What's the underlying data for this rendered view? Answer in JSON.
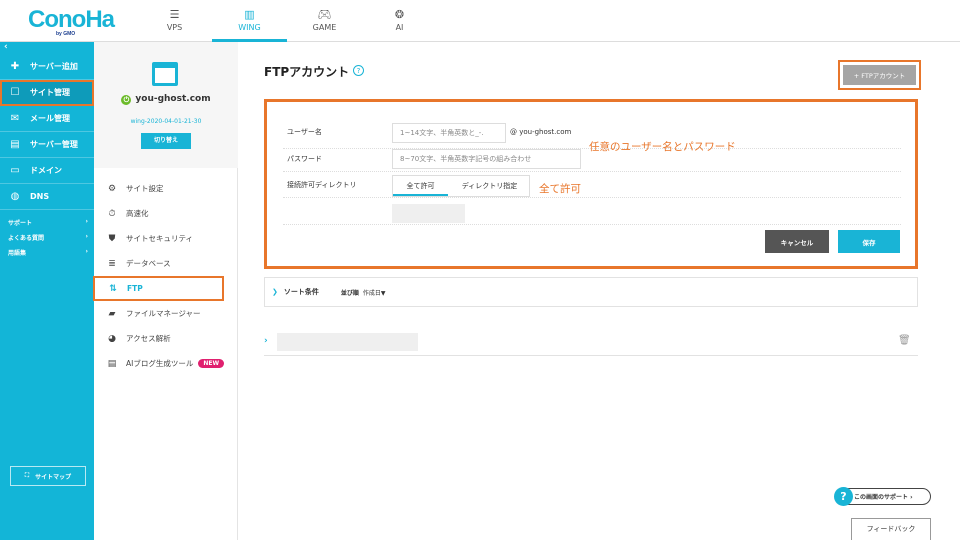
{
  "header": {
    "logo": "ConoHa",
    "logo_sub": "by GMO",
    "tabs": [
      {
        "label": "VPS",
        "icon": "server-icon"
      },
      {
        "label": "WING",
        "icon": "wing-icon"
      },
      {
        "label": "GAME",
        "icon": "gamepad-icon"
      },
      {
        "label": "AI",
        "icon": "brain-icon"
      }
    ]
  },
  "sidebar": {
    "collapse": "‹",
    "items": [
      {
        "label": "サーバー追加",
        "icon": "plus-icon"
      },
      {
        "label": "サイト管理",
        "icon": "window-icon"
      },
      {
        "label": "メール管理",
        "icon": "mail-icon"
      },
      {
        "label": "サーバー管理",
        "icon": "server-icon"
      },
      {
        "label": "ドメイン",
        "icon": "domain-icon"
      },
      {
        "label": "DNS",
        "icon": "globe-icon"
      }
    ],
    "links": [
      "サポート",
      "よくある質問",
      "用語集"
    ],
    "sitemap": "サイトマップ"
  },
  "subpanel": {
    "domain": "you-ghost.com",
    "wing_id": "wing-2020-04-01-21-30",
    "switch": "切り替え",
    "menu": [
      {
        "label": "サイト設定",
        "icon": "site-settings-icon"
      },
      {
        "label": "高速化",
        "icon": "stopwatch-icon"
      },
      {
        "label": "サイトセキュリティ",
        "icon": "shield-icon"
      },
      {
        "label": "データベース",
        "icon": "database-icon"
      },
      {
        "label": "FTP",
        "icon": "ftp-arrows-icon"
      },
      {
        "label": "ファイルマネージャー",
        "icon": "folder-icon"
      },
      {
        "label": "アクセス解析",
        "icon": "pie-chart-icon"
      },
      {
        "label": "AIブログ生成ツール",
        "icon": "document-icon"
      }
    ],
    "new_badge": "NEW"
  },
  "main": {
    "title": "FTPアカウント",
    "help": "?",
    "add_button": "+ FTPアカウント",
    "form": {
      "username_label": "ユーザー名",
      "username_placeholder": "1~14文字、半角英数と_-.",
      "domain_suffix": "@ you-ghost.com",
      "password_label": "パスワード",
      "password_placeholder": "8~70文字、半角英数字記号の組み合わせ",
      "dir_label": "接続許可ディレクトリ",
      "dir_tabs": [
        "全て許可",
        "ディレクトリ指定"
      ],
      "cancel": "キャンセル",
      "save": "保存"
    },
    "annotations": {
      "credentials": "任意のユーザー名とパスワード",
      "all_allowed": "全て許可"
    },
    "sort": {
      "label": "ソート条件",
      "order_label": "並び順",
      "order_value": "作成日▼"
    }
  },
  "footer": {
    "support": "この画面のサポート ›",
    "feedback": "フィードバック"
  },
  "colors": {
    "accent": "#13b5d7",
    "highlight": "#e8762b"
  }
}
